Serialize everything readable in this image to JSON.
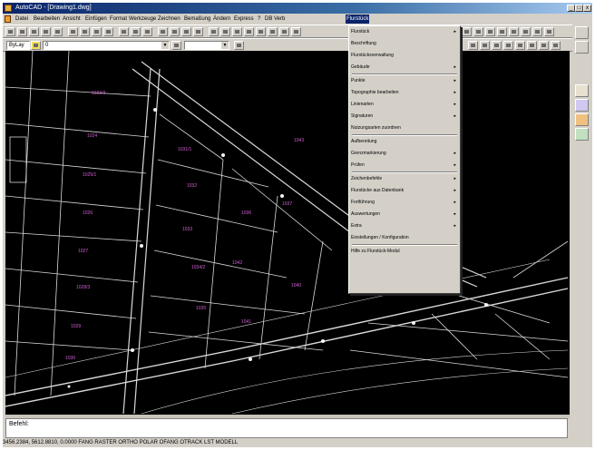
{
  "window": {
    "title": "AutoCAD - [Drawing1.dwg]",
    "minimize_glyph": "_",
    "maximize_glyph": "□",
    "close_glyph": "x"
  },
  "menubar": {
    "items": [
      "Datei",
      "Bearbeiten",
      "Ansicht",
      "Einfügen",
      "Format",
      "Werkzeuge",
      "Zeichnen",
      "Bemaßung",
      "Ändern",
      "Express",
      "?",
      "DB Verb",
      "Flurstück"
    ]
  },
  "toolbar2": {
    "layer_value": "ByLay",
    "linetype_value": "0",
    "color_value": ""
  },
  "dropdown": {
    "items": [
      {
        "label": "Flurstück",
        "submenu": true
      },
      {
        "label": "Beschriftung",
        "submenu": false
      },
      {
        "label": "Flurstücksverwaltung",
        "submenu": false
      },
      {
        "label": "Gebäude",
        "submenu": true
      },
      {
        "label": "Punkte",
        "submenu": true
      },
      {
        "label": "Topographie bearbeiten",
        "submenu": true
      },
      {
        "label": "Linienarten",
        "submenu": true
      },
      {
        "label": "Signaturen",
        "submenu": true
      },
      {
        "label": "Nutzungsarten zuordnen",
        "submenu": false
      },
      {
        "label": "Aufbereitung",
        "submenu": false
      },
      {
        "label": "Grenzmarkierung",
        "submenu": true
      },
      {
        "label": "Prüfen",
        "submenu": true
      },
      {
        "label": "Zeichenbefehle",
        "submenu": true
      },
      {
        "label": "Flurstücke aus Datenbank",
        "submenu": true
      },
      {
        "label": "Fortführung",
        "submenu": true
      },
      {
        "label": "Auswertungen",
        "submenu": true
      },
      {
        "label": "Extra",
        "submenu": true
      },
      {
        "label": "Einstellungen / Konfiguration",
        "submenu": false
      },
      {
        "label": "Hilfe zu Flurstück-Modul",
        "submenu": false
      }
    ]
  },
  "drawing": {
    "parcel_labels": [
      "1023/2",
      "1024",
      "1025/1",
      "1026",
      "1027",
      "1028/3",
      "1029",
      "1030",
      "1031/1",
      "1032",
      "1033",
      "1034/2",
      "1035",
      "1036",
      "1037",
      "1040",
      "1041",
      "1042",
      "1043",
      "1044"
    ],
    "label_color": "#d060d0",
    "line_color": "#ffffff"
  },
  "commandline": {
    "line1": "Befehl:",
    "line2": ""
  },
  "statusbar": {
    "text": "3456.2384, 5612.8810, 0.0000   FANG  RASTER  ORTHO  POLAR  OFANG  OTRACK  LST  MODELL"
  }
}
